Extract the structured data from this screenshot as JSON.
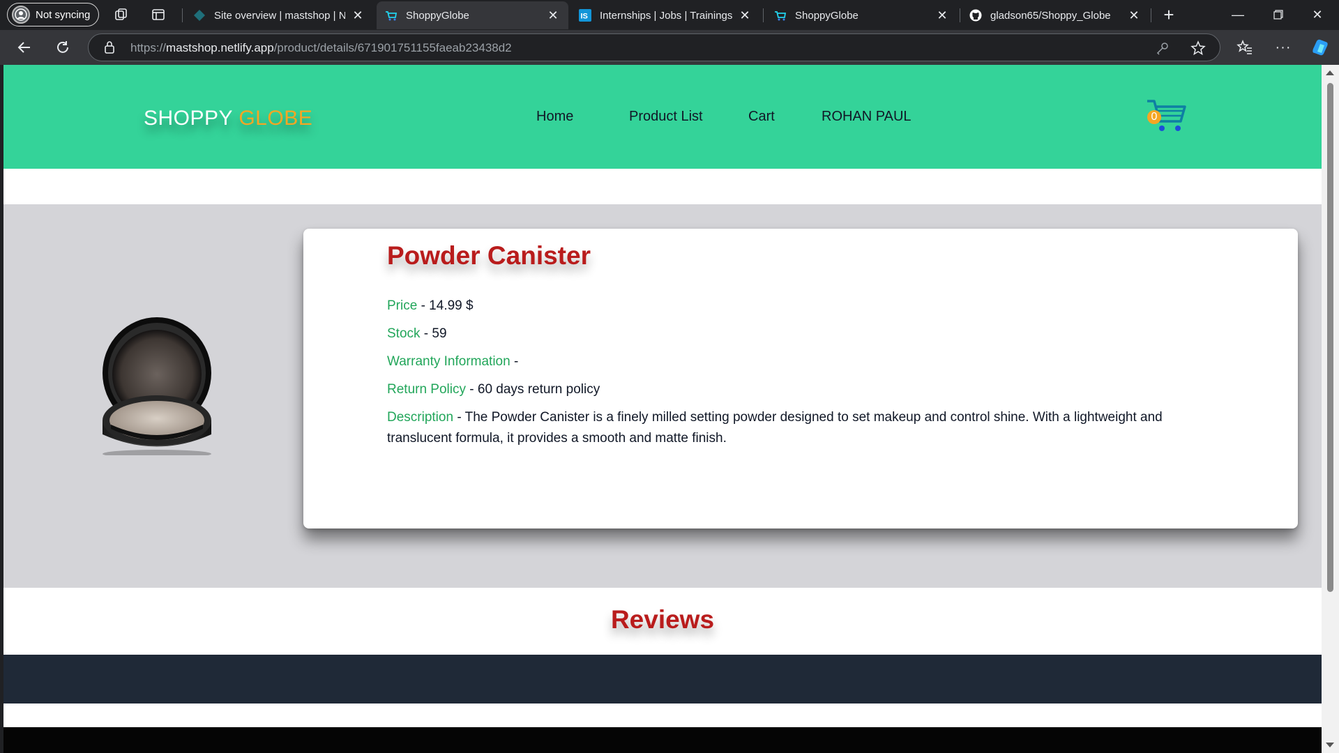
{
  "browser": {
    "profile_label": "Not syncing",
    "tabs": [
      {
        "title": "Site overview | mastshop | Netlify",
        "active": false
      },
      {
        "title": "ShoppyGlobe",
        "active": true
      },
      {
        "title": "Internships | Jobs | Trainings & more",
        "active": false
      },
      {
        "title": "ShoppyGlobe",
        "active": false
      },
      {
        "title": "gladson65/Shoppy_Globe",
        "active": false
      }
    ],
    "favicon_texts": {
      "internshala": "IS"
    },
    "url": {
      "scheme": "https://",
      "host": "mastshop.netlify.app",
      "path": "/product/details/671901751155faeab23438d2"
    }
  },
  "site": {
    "logo_word1": "SHOPPY",
    "logo_word2": "GLOBE",
    "nav": [
      "Home",
      "Product List",
      "Cart",
      "ROHAN PAUL"
    ],
    "cart_count": "0"
  },
  "product": {
    "title": "Powder Canister",
    "price_label": "Price",
    "price_value": " - 14.99 $",
    "stock_label": "Stock",
    "stock_value": " - 59",
    "warranty_label": "Warranty Information",
    "warranty_value": " -",
    "return_label": "Return Policy",
    "return_value": " - 60 days return policy",
    "description_label": "Description",
    "description_value": " - The Powder Canister is a finely milled setting powder designed to set makeup and control shine. With a lightweight and translucent formula, it provides a smooth and matte finish."
  },
  "reviews": {
    "title": "Reviews"
  },
  "colors": {
    "header_bg": "#34d399",
    "accent_orange": "#f5a623",
    "title_red": "#b91c1c",
    "label_green": "#22a65a",
    "product_band": "#d4d4d8",
    "reviews_band": "#1f2937"
  }
}
